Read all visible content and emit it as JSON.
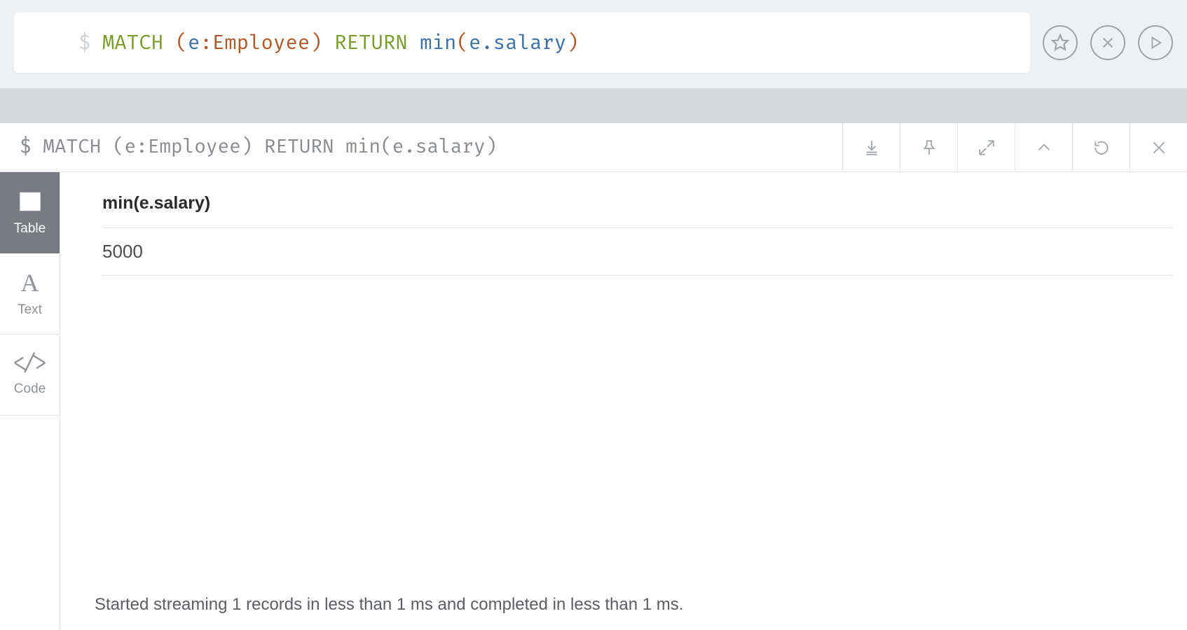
{
  "editor": {
    "prompt": "$",
    "tokens": {
      "match": "MATCH",
      "lp1": "(",
      "var_e": "e",
      "colon": ":",
      "label": "Employee",
      "rp1": ")",
      "return": "RETURN",
      "func": "min",
      "lp2": "(",
      "var_e2": "e",
      "dot": ".",
      "prop": "salary",
      "rp2": ")"
    }
  },
  "editor_actions": {
    "favorite": "Favorite",
    "clear": "Clear",
    "run": "Run"
  },
  "result": {
    "query_echo": "$ MATCH (e:Employee) RETURN min(e.salary)",
    "header_actions": {
      "export": "Export",
      "pin": "Pin",
      "fullscreen": "Fullscreen",
      "collapse": "Collapse",
      "rerun": "Re-run",
      "close": "Close"
    },
    "tabs": {
      "table": "Table",
      "text": "Text",
      "code": "Code"
    },
    "table": {
      "columns": [
        "min(e.salary)"
      ],
      "rows": [
        [
          "5000"
        ]
      ]
    },
    "status": "Started streaming 1 records in less than 1 ms and completed in less than 1 ms."
  }
}
